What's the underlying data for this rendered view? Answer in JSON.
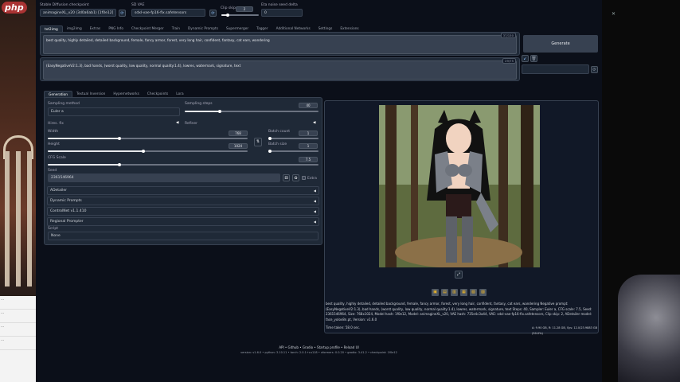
{
  "logo": "php",
  "left_panel": [
    "...",
    "...",
    "...",
    "..."
  ],
  "header": {
    "checkpoint_label": "Stable Diffusion checkpoint",
    "checkpoint_value": "animagineXL_v20 (3d0a6ab1) [1f0e12]",
    "vae_label": "SD VAE",
    "vae_value": "sdxl-vae-fp16-fix.safetensors",
    "clip_label": "Clip skip",
    "clip_value": "2",
    "noise_label": "Eta noise seed delta",
    "noise_value": "0"
  },
  "main_tabs": [
    "txt2img",
    "img2img",
    "Extras",
    "PNG Info",
    "Checkpoint Merger",
    "Train",
    "Dynamic Prompts",
    "Supermerger",
    "Tagger",
    "Additional Networks",
    "Settings",
    "Extensions"
  ],
  "prompt": {
    "text": "best quality, highly detailed, detailed background, female, fancy armor, forest, very long hair, confident, fantasy, cat ears, wandering",
    "counter": "37/150"
  },
  "negative_prompt": {
    "text": "(EasyNegativeV2:1.3), bad hands, (worst quality, low quality, normal quality:1.4), lowres, watermark, signature, text",
    "counter": "29/75"
  },
  "generate_label": "Generate",
  "sub_tabs": [
    "Generation",
    "Textual Inversion",
    "Hypernetworks",
    "Checkpoints",
    "Lora"
  ],
  "sampling": {
    "method_label": "Sampling method",
    "method_value": "Euler a",
    "steps_label": "Sampling steps",
    "steps_value": "40"
  },
  "options": {
    "hires_fix": "Hires. fix",
    "refiner": "Refiner"
  },
  "size": {
    "width_label": "Width",
    "width_value": "768",
    "height_label": "Height",
    "height_value": "1024",
    "batch_count_label": "Batch count",
    "batch_count_value": "1",
    "batch_size_label": "Batch size",
    "batch_size_value": "1"
  },
  "cfg": {
    "label": "CFG Scale",
    "value": "7.5"
  },
  "seed": {
    "label": "Seed",
    "value": "2361546964",
    "extra_label": "Extra"
  },
  "accordions": [
    "ADetailer",
    "Dynamic Prompts",
    "ControlNet v1.1.410",
    "Regional Prompter"
  ],
  "script": {
    "label": "Script",
    "value": "None"
  },
  "image_info": "best quality, highly detailed, detailed background, female, fancy armor, forest, very long hair, confident, fantasy, cat ears, wandering Negative prompt: (EasyNegativeV2:1.3), bad hands, (worst quality, low quality, normal quality:1.4), lowres, watermark, signature, text Steps: 40, Sampler: Euler a, CFG scale: 7.5, Seed: 2361546964, Size: 768x1024, Model hash: 1f0e12, Model: animagineXL_v20, VAE hash: 735e4c3a44, VAE: sdxl-vae-fp16-fix.safetensors, Clip skip: 2, ADetailer model: face_yolov8n.pt, Version: v1.6.0",
  "time_taken": "Time taken: 58.0 sec.",
  "vram": "A: 9.90 GB, R: 11.28 GB, Sys: 12.0/23.9883 GB (50.0%)",
  "footer_links": "API  •  Github  •  Gradio  •  Startup profile  •  Reload UI",
  "footer_versions": "version: v1.6.0  •  python: 3.10.11  •  torch: 2.0.1+cu118  •  xformers: 0.0.20  •  gradio: 3.41.2  •  checkpoint: 1f0e12",
  "colors": {
    "accent": "#f97316",
    "background": "#0b0f19"
  }
}
